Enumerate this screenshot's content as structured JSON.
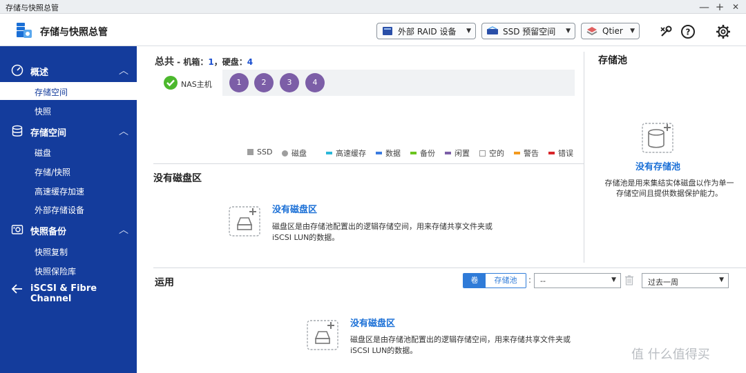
{
  "window": {
    "title": "存储与快照总管",
    "minimize": "—",
    "maximize": "+",
    "close": "✕"
  },
  "header": {
    "app_title": "存储与快照总管",
    "btn_external_raid": "外部 RAID 设备",
    "btn_ssd_reserve": "SSD 预留空间",
    "btn_qtier": "Qtier"
  },
  "sidebar": {
    "overview": {
      "label": "概述",
      "items": [
        "存储空间",
        "快照"
      ]
    },
    "storage": {
      "label": "存储空间",
      "items": [
        "磁盘",
        "存储/快照",
        "高速缓存加速",
        "外部存储设备"
      ]
    },
    "snapshot_backup": {
      "label": "快照备份",
      "items": [
        "快照复制",
        "快照保险库"
      ]
    },
    "iscsi": {
      "label": "iSCSI & Fibre Channel"
    }
  },
  "summary": {
    "total_label": "总共",
    "enclosure_label": " - 机箱：",
    "enclosure_count": "1",
    "disk_label": "，硬盘：",
    "disk_count": "4",
    "nas_label": "NAS主机",
    "disks": [
      "1",
      "2",
      "3",
      "4"
    ]
  },
  "legend": [
    {
      "label": "SSD",
      "color": "#9e9e9e",
      "shape": "square"
    },
    {
      "label": "磁盘",
      "color": "#9e9e9e",
      "shape": "circle"
    },
    {
      "label": "高速缓存",
      "color": "#2bb7d9",
      "shape": "bar"
    },
    {
      "label": "数据",
      "color": "#3a7be0",
      "shape": "square"
    },
    {
      "label": "备份",
      "color": "#6bc51f",
      "shape": "bar"
    },
    {
      "label": "闲置",
      "color": "#7c5ea7",
      "shape": "bar"
    },
    {
      "label": "空的",
      "color": "#ffffff",
      "shape": "square"
    },
    {
      "label": "警告",
      "color": "#f39a1e",
      "shape": "bar"
    },
    {
      "label": "错误",
      "color": "#d8252a",
      "shape": "bar"
    }
  ],
  "no_volume_section": {
    "title": "没有磁盘区",
    "placeholder_title": "没有磁盘区",
    "desc_line1": "磁盘区是由存储池配置出的逻辑存储空间，用来存储共享文件夹或",
    "desc_line2": "iSCSI LUN的数据。"
  },
  "pool_panel": {
    "title": "存储池",
    "placeholder_title": "没有存储池",
    "desc": "存储池是用来集结实体磁盘以作为单一存储空间且提供数据保护能力。"
  },
  "usage": {
    "title": "运用",
    "tab_volume": "卷",
    "tab_pool": "存储池",
    "colon": ":",
    "select_value": "--",
    "period_value": "过去一周",
    "placeholder_title": "没有磁盘区",
    "desc_line1": "磁盘区是由存储池配置出的逻辑存储空间，用来存储共享文件夹或",
    "desc_line2": "iSCSI LUN的数据。"
  },
  "watermark": "值 什么值得买",
  "colors": {
    "sidebar_bg": "#143c9c",
    "link_blue": "#1a6fd6",
    "disk_purple": "#7c5ea7",
    "accent_blue": "#2f7bd8"
  }
}
